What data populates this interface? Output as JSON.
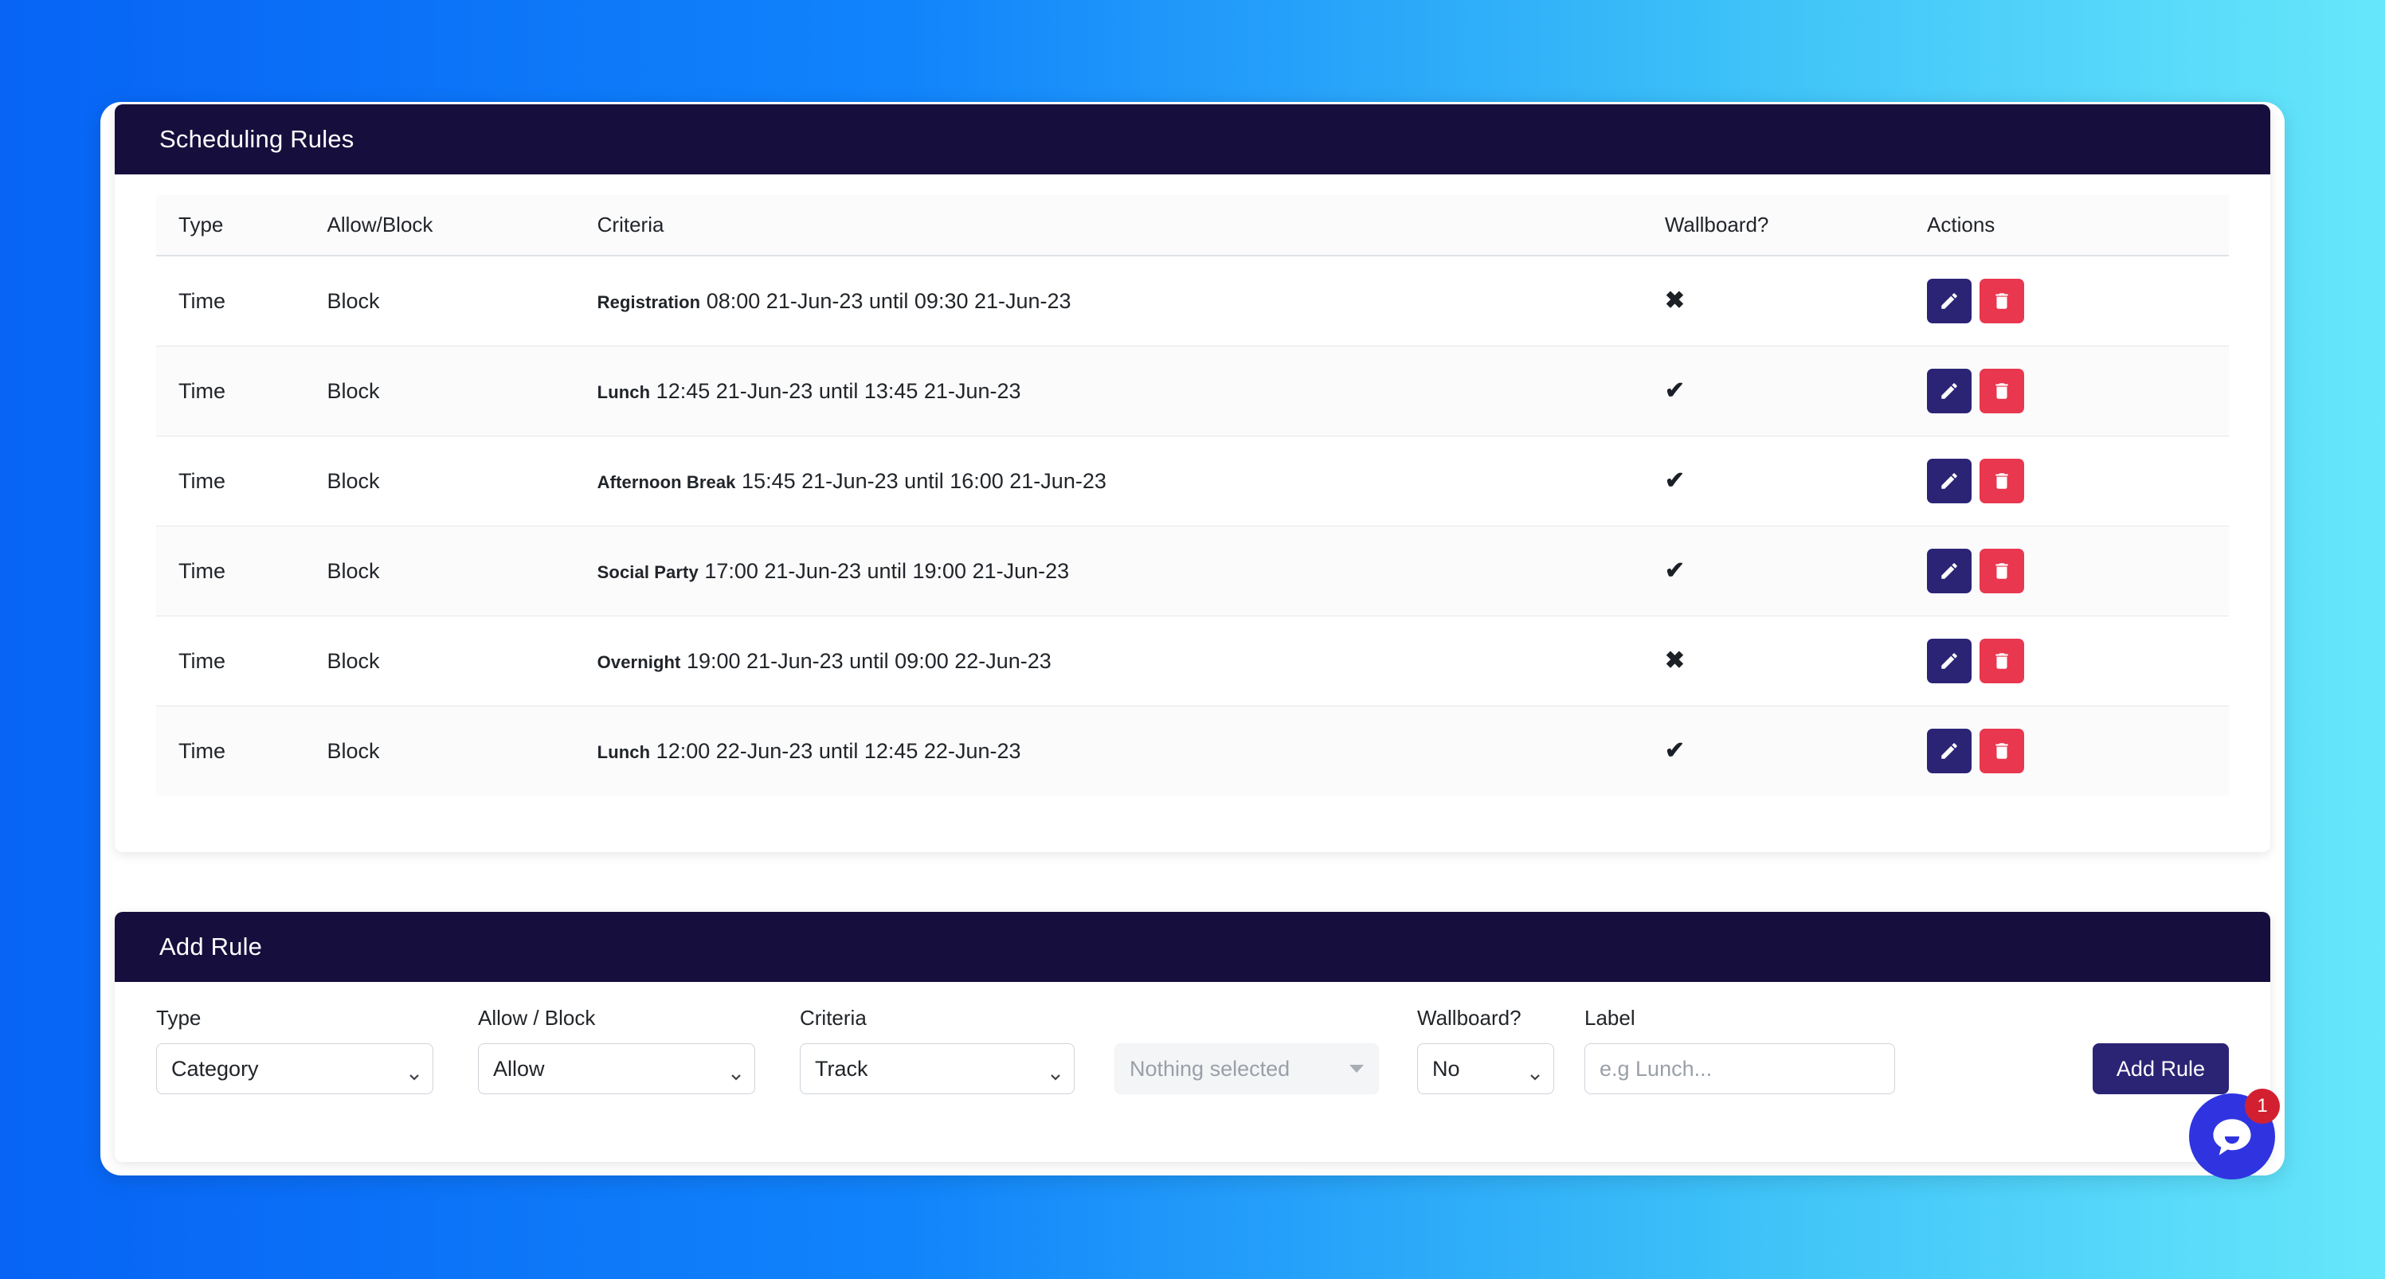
{
  "rules_card": {
    "title": "Scheduling Rules",
    "table": {
      "columns": [
        "Type",
        "Allow/Block",
        "Criteria",
        "Wallboard?",
        "Actions"
      ],
      "rows": [
        {
          "type": "Time",
          "allow_block": "Block",
          "criteria_label": "Registration",
          "criteria_text": "08:00 21-Jun-23 until 09:30 21-Jun-23",
          "wallboard": "no",
          "wallboard_icon": "cross-icon",
          "actions": [
            "edit",
            "delete"
          ]
        },
        {
          "type": "Time",
          "allow_block": "Block",
          "criteria_label": "Lunch",
          "criteria_text": "12:45 21-Jun-23 until 13:45 21-Jun-23",
          "wallboard": "yes",
          "wallboard_icon": "check-icon",
          "actions": [
            "edit",
            "delete"
          ]
        },
        {
          "type": "Time",
          "allow_block": "Block",
          "criteria_label": "Afternoon Break",
          "criteria_text": "15:45 21-Jun-23 until 16:00 21-Jun-23",
          "wallboard": "yes",
          "wallboard_icon": "check-icon",
          "actions": [
            "edit",
            "delete"
          ]
        },
        {
          "type": "Time",
          "allow_block": "Block",
          "criteria_label": "Social Party",
          "criteria_text": "17:00 21-Jun-23 until 19:00 21-Jun-23",
          "wallboard": "yes",
          "wallboard_icon": "check-icon",
          "actions": [
            "edit",
            "delete"
          ]
        },
        {
          "type": "Time",
          "allow_block": "Block",
          "criteria_label": "Overnight",
          "criteria_text": "19:00 21-Jun-23 until 09:00 22-Jun-23",
          "wallboard": "no",
          "wallboard_icon": "cross-icon",
          "actions": [
            "edit",
            "delete"
          ]
        },
        {
          "type": "Time",
          "allow_block": "Block",
          "criteria_label": "Lunch",
          "criteria_text": "12:00 22-Jun-23 until 12:45 22-Jun-23",
          "wallboard": "yes",
          "wallboard_icon": "check-icon",
          "actions": [
            "edit",
            "delete"
          ]
        }
      ],
      "icons": {
        "check": "✔",
        "cross": "✖"
      }
    }
  },
  "add_card": {
    "title": "Add Rule",
    "fields": {
      "type": {
        "label": "Type",
        "value": "Category"
      },
      "allow_block": {
        "label": "Allow / Block",
        "value": "Allow"
      },
      "criteria": {
        "label": "Criteria",
        "value": "Track"
      },
      "multiselect": {
        "value": "Nothing selected"
      },
      "wallboard": {
        "label": "Wallboard?",
        "value": "No"
      },
      "rule_label": {
        "label": "Label",
        "value": "",
        "placeholder": "e.g Lunch..."
      }
    },
    "submit_label": "Add Rule"
  },
  "chat_widget": {
    "badge_count": "1",
    "icon": "chat-bubble-icon"
  },
  "colors": {
    "header_navy": "#160f3d",
    "edit_button": "#2b2475",
    "delete_button": "#e8374f",
    "primary_button": "#2b2475",
    "chat_blue": "#2f34e0",
    "badge_red": "#d32030",
    "bg_gradient_start": "#0764f5",
    "bg_gradient_end": "#66e7fb"
  }
}
